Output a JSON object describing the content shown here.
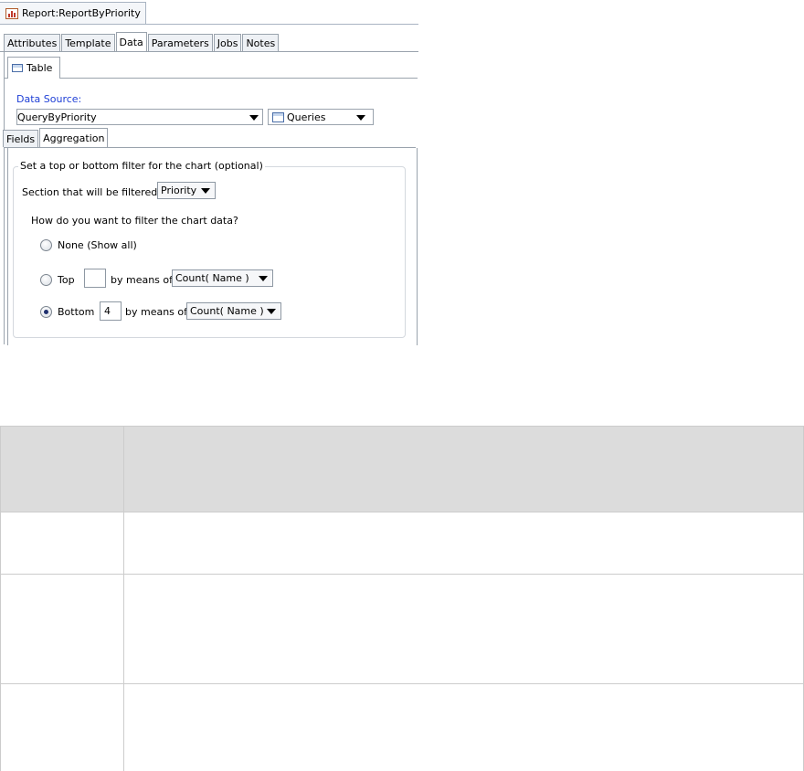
{
  "editor": {
    "tab_title": "Report:ReportByPriority",
    "icon": "report-chart-icon"
  },
  "main_tabs": [
    {
      "label": "Attributes",
      "active": false
    },
    {
      "label": "Template",
      "active": false
    },
    {
      "label": "Data",
      "active": true
    },
    {
      "label": "Parameters",
      "active": false
    },
    {
      "label": "Jobs",
      "active": false
    },
    {
      "label": "Notes",
      "active": false
    }
  ],
  "sub_tab": {
    "label": "Table",
    "icon": "table-icon"
  },
  "data_source": {
    "label": "Data Source:",
    "value": "QueryByPriority",
    "queries_button": "Queries"
  },
  "agg_tabs": [
    {
      "label": "Fields",
      "active": false
    },
    {
      "label": "Aggregation",
      "active": true
    }
  ],
  "filter": {
    "group_title": "Set a top or bottom filter for the chart (optional)",
    "section_label": "Section that will be filtered:",
    "section_value": "Priority",
    "question": "How do you want to filter the chart data?",
    "none_label": "None (Show all)",
    "top_label": "Top",
    "top_value": "",
    "top_means_label": "by means of",
    "top_means_value": "Count( Name )",
    "bottom_label": "Bottom",
    "bottom_value": "4",
    "bottom_means_label": "by means of",
    "bottom_means_value": "Count( Name )",
    "selected": "bottom"
  },
  "colors": {
    "label_blue": "#1e3fd6",
    "table_header": "#dcdcdc",
    "table_border": "#cccccc"
  }
}
